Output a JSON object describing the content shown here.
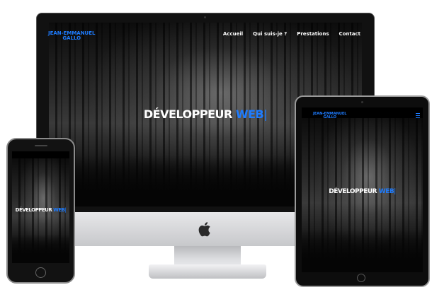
{
  "brand": {
    "line1": "JEAN-EMMANUEL",
    "line2": "GALLO"
  },
  "nav": {
    "items": [
      "Accueil",
      "Qui suis-je ?",
      "Prestations",
      "Contact"
    ]
  },
  "hero": {
    "title": "DÉVELOPPEUR",
    "accent": "WEB",
    "cursor": "|"
  },
  "colors": {
    "accent": "#1e7cff",
    "background": "#000000",
    "text": "#ffffff"
  },
  "icons": {
    "apple": "apple-logo-icon",
    "menu": "hamburger-menu-icon"
  }
}
